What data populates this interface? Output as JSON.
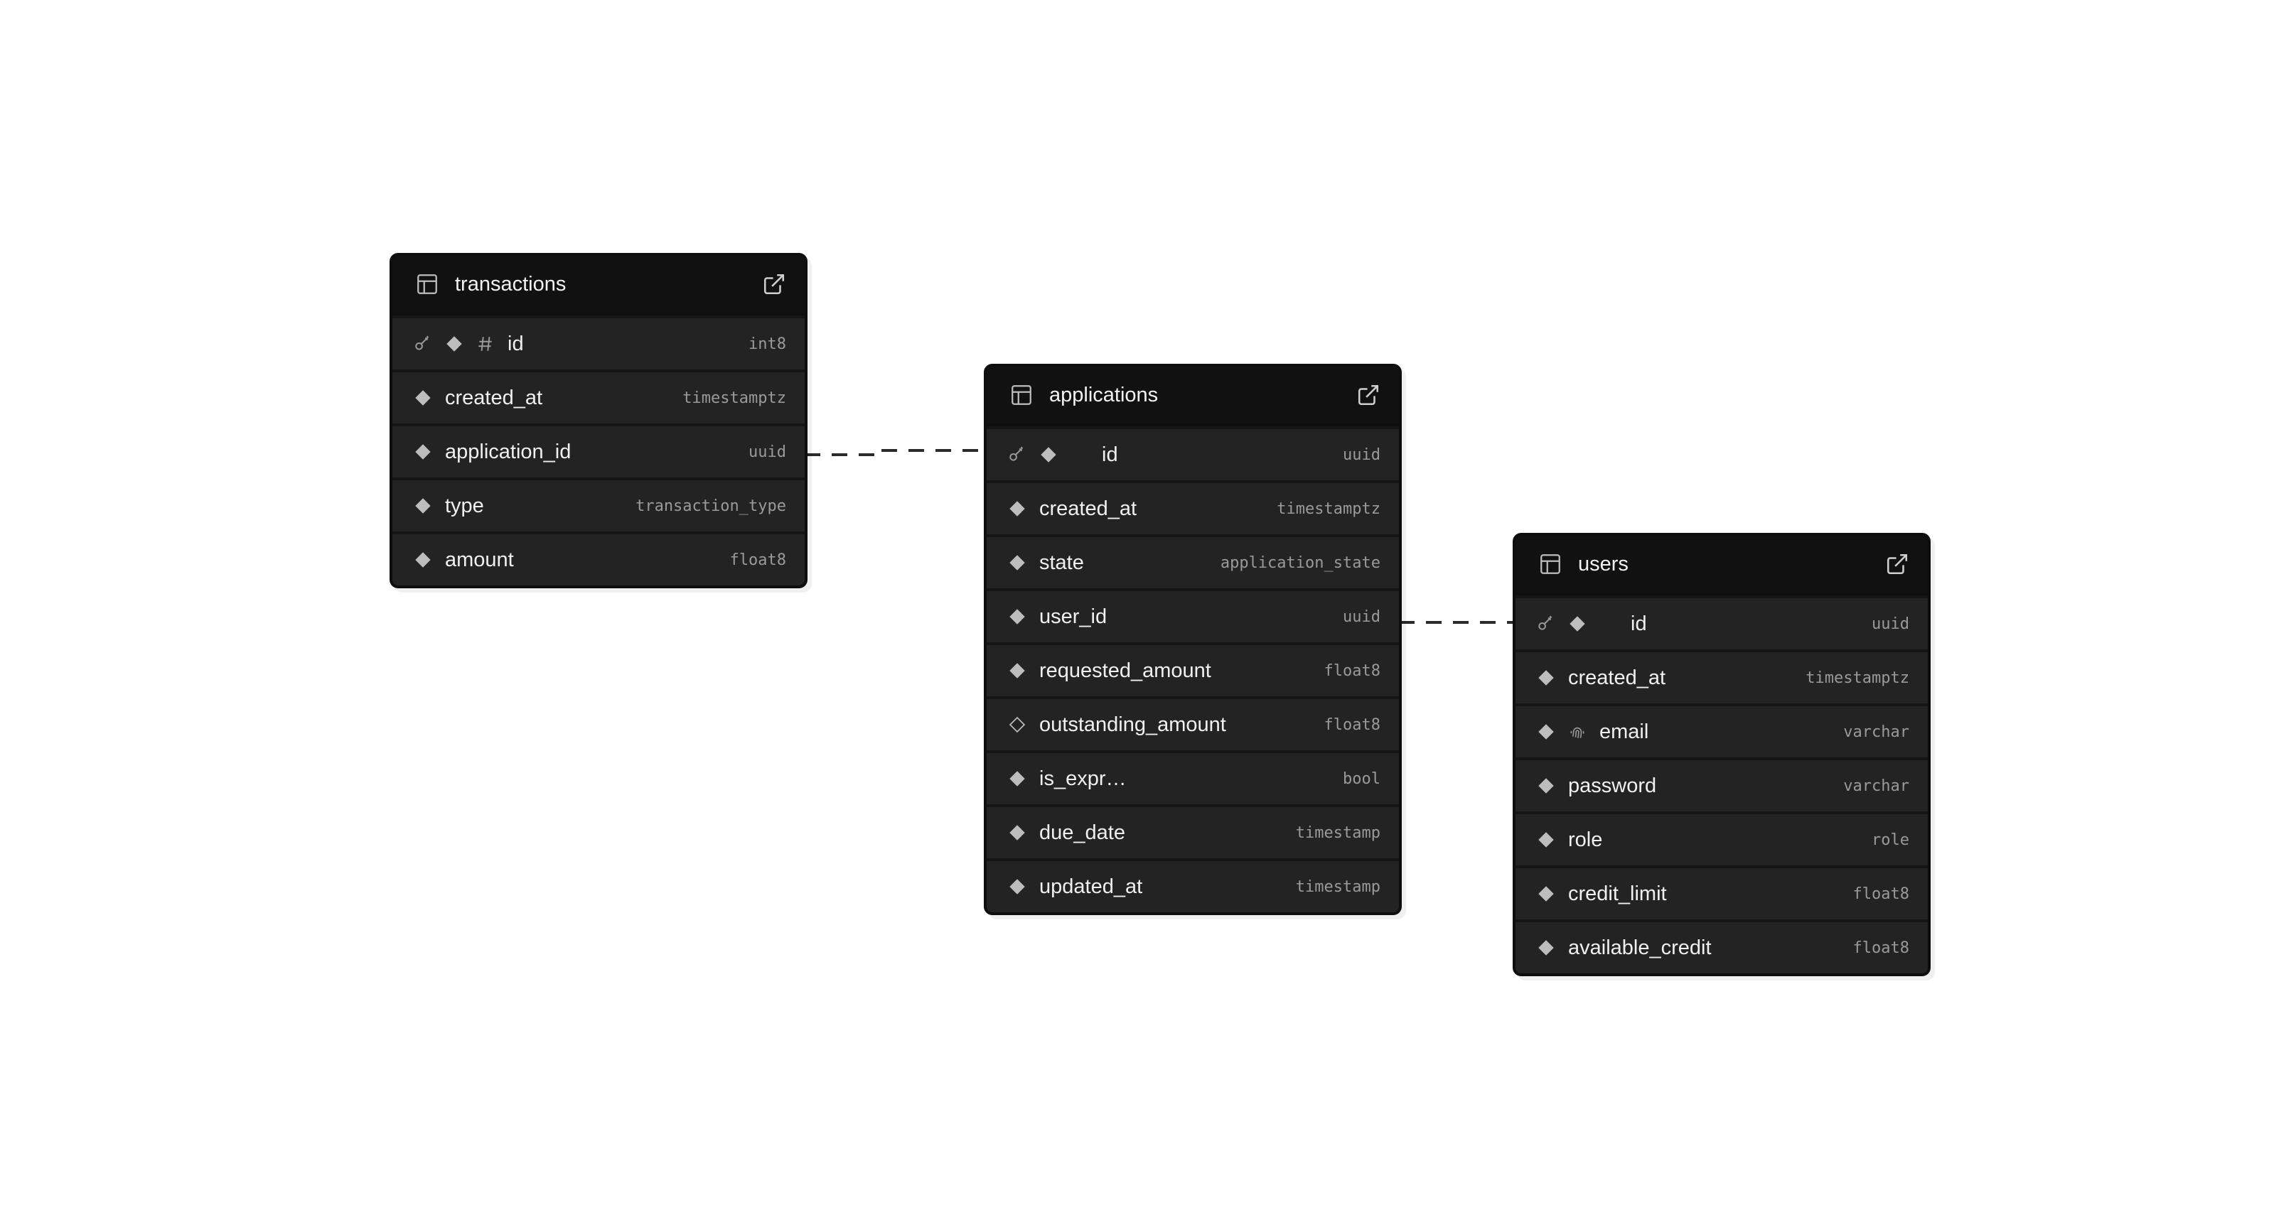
{
  "tables": {
    "transactions": {
      "name": "transactions",
      "columns": [
        {
          "name": "id",
          "type": "int8",
          "primary_key": true,
          "identity": true,
          "nullable": false
        },
        {
          "name": "created_at",
          "type": "timestamptz",
          "nullable": false
        },
        {
          "name": "application_id",
          "type": "uuid",
          "nullable": false
        },
        {
          "name": "type",
          "type": "transaction_type",
          "nullable": false
        },
        {
          "name": "amount",
          "type": "float8",
          "nullable": false
        }
      ]
    },
    "applications": {
      "name": "applications",
      "columns": [
        {
          "name": "id",
          "type": "uuid",
          "primary_key": true,
          "nullable": false
        },
        {
          "name": "created_at",
          "type": "timestamptz",
          "nullable": false
        },
        {
          "name": "state",
          "type": "application_state",
          "nullable": false
        },
        {
          "name": "user_id",
          "type": "uuid",
          "nullable": false
        },
        {
          "name": "requested_amount",
          "type": "float8",
          "nullable": false
        },
        {
          "name": "outstanding_amount",
          "type": "float8",
          "nullable": true
        },
        {
          "name": "is_expr…",
          "type": "bool",
          "nullable": false
        },
        {
          "name": "due_date",
          "type": "timestamp",
          "nullable": false
        },
        {
          "name": "updated_at",
          "type": "timestamp",
          "nullable": false
        }
      ]
    },
    "users": {
      "name": "users",
      "columns": [
        {
          "name": "id",
          "type": "uuid",
          "primary_key": true,
          "nullable": false
        },
        {
          "name": "created_at",
          "type": "timestamptz",
          "nullable": false
        },
        {
          "name": "email",
          "type": "varchar",
          "unique": true,
          "nullable": false
        },
        {
          "name": "password",
          "type": "varchar",
          "nullable": false
        },
        {
          "name": "role",
          "type": "role",
          "nullable": false
        },
        {
          "name": "credit_limit",
          "type": "float8",
          "nullable": false
        },
        {
          "name": "available_credit",
          "type": "float8",
          "nullable": false
        }
      ]
    }
  },
  "relations": [
    {
      "from_table": "transactions",
      "from_column": "application_id",
      "to_table": "applications",
      "to_column": "id"
    },
    {
      "from_table": "applications",
      "to_table": "users",
      "from_column": "user_id",
      "to_column": "id"
    }
  ],
  "colors": {
    "canvas": "#ffffff",
    "card": "#1f1f1f",
    "header": "#111111",
    "text": "#f0f0f0",
    "type_text": "#9a9a9a",
    "icon": "#bdbdbd",
    "connector": "#2a2a2a"
  }
}
